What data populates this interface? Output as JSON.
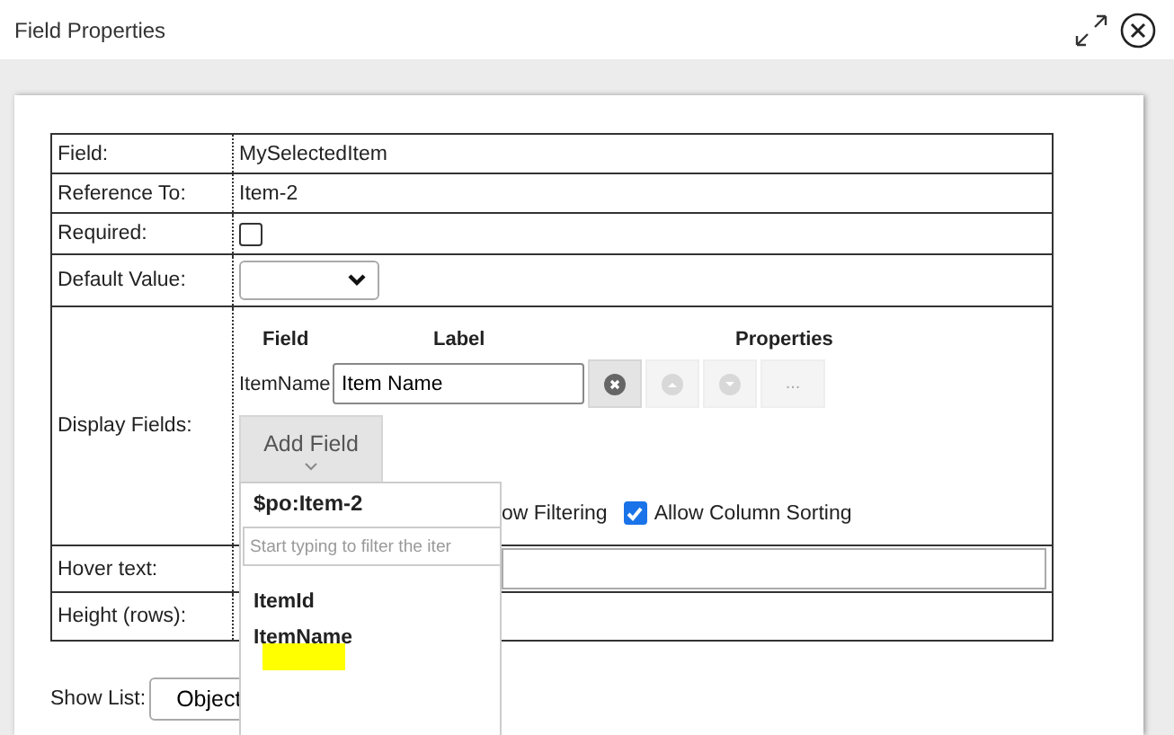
{
  "window": {
    "title": "Field Properties"
  },
  "rows": [
    {
      "kind": "text",
      "label": "Field:",
      "value": "MySelectedItem"
    },
    {
      "kind": "text",
      "label": "Reference To:",
      "value": "Item-2"
    },
    {
      "kind": "checkbox",
      "label": "Required:",
      "checked": false
    },
    {
      "kind": "select",
      "label": "Default Value:"
    },
    {
      "kind": "display_fields",
      "label": "Display Fields:"
    },
    {
      "kind": "input",
      "label": "Hover text:"
    },
    {
      "kind": "covered",
      "label": "Height (rows):"
    }
  ],
  "display_fields": {
    "columns": [
      "Field",
      "Label",
      "Properties"
    ],
    "items": [
      {
        "field": "ItemName",
        "label": "Item Name",
        "buttons": [
          {
            "kind": "remove",
            "disabled": false
          },
          {
            "kind": "up",
            "disabled": true
          },
          {
            "kind": "down",
            "disabled": true
          },
          {
            "kind": "more",
            "text": "...",
            "disabled": true
          }
        ]
      }
    ],
    "add_button": "Add Field",
    "options": [
      {
        "kind": "text",
        "label": "ow Filtering"
      },
      {
        "kind": "checkbox",
        "label": "Allow Column Sorting",
        "checked": true
      }
    ]
  },
  "show_list": {
    "label": "Show List:",
    "value": "Object"
  },
  "popup": {
    "title": "$po:Item-2",
    "placeholder": "Start typing to filter the iter",
    "items": [
      {
        "label": "ItemId",
        "highlighted": false
      },
      {
        "label": "ItemName",
        "highlighted": true
      }
    ]
  }
}
